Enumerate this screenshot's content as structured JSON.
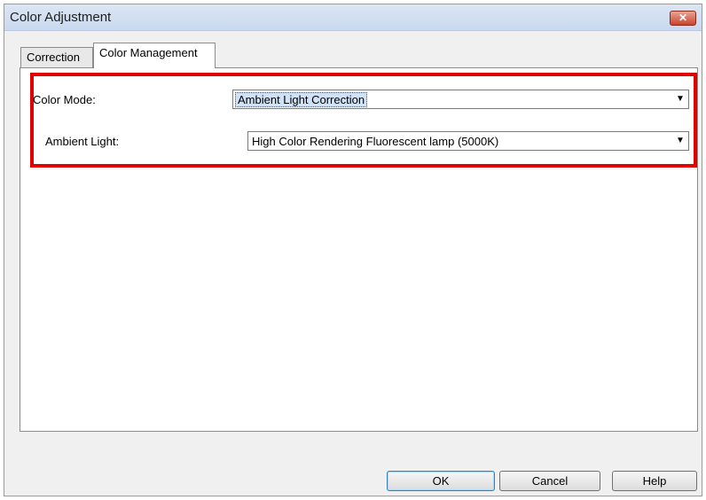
{
  "window": {
    "title": "Color Adjustment",
    "close_label": "✕"
  },
  "tabs": [
    {
      "label": "Correction",
      "active": false
    },
    {
      "label": "Color Management",
      "active": true
    }
  ],
  "color_management": {
    "color_mode_label": "Color Mode:",
    "color_mode_value": "Ambient Light Correction",
    "ambient_light_label": "Ambient Light:",
    "ambient_light_value": "High Color Rendering Fluorescent lamp (5000K)"
  },
  "buttons": {
    "ok": "OK",
    "cancel": "Cancel",
    "help": "Help"
  },
  "colors": {
    "highlight": "#e00000",
    "title_bar": "#c9d9ee"
  }
}
